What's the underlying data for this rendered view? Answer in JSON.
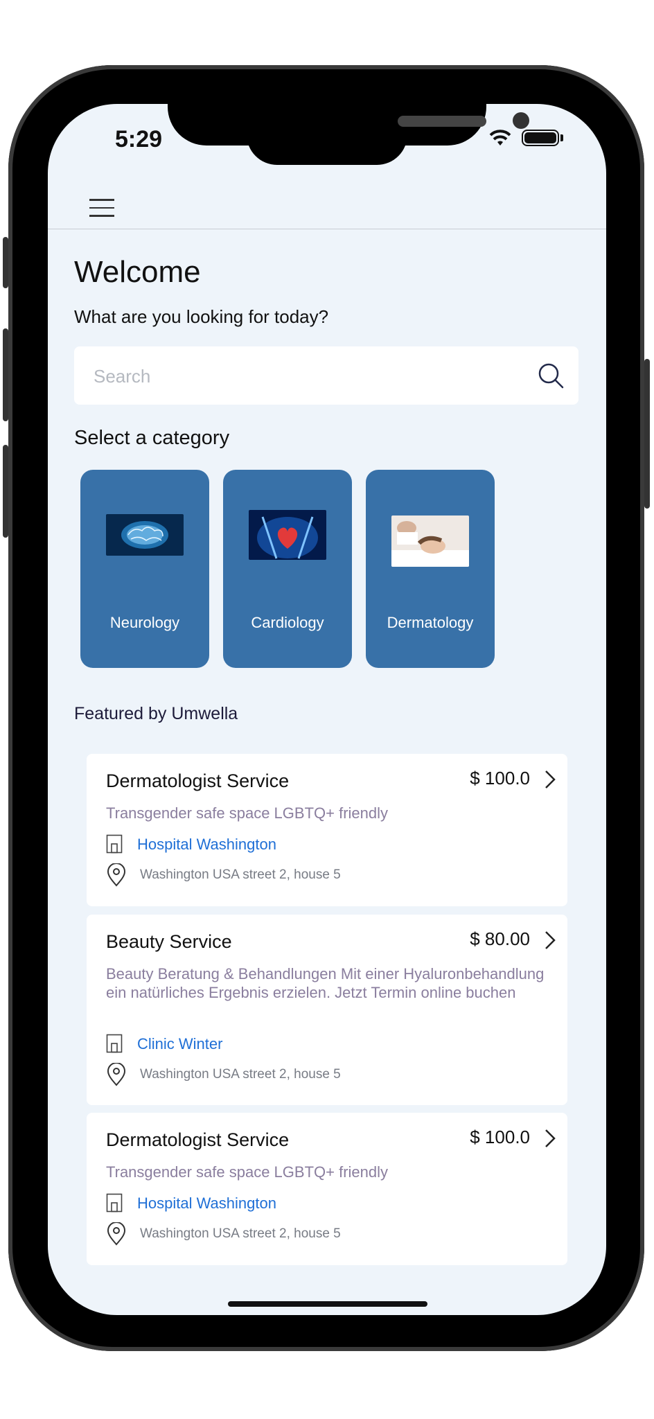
{
  "status_bar": {
    "time": "5:29"
  },
  "header": {
    "menu_icon": "hamburger-menu-icon"
  },
  "welcome": {
    "title": "Welcome",
    "subtitle": "What are you looking for today?"
  },
  "search": {
    "placeholder": "Search",
    "value": ""
  },
  "categories": {
    "title": "Select a category",
    "items": [
      {
        "label": "Neurology",
        "image": "brain-image"
      },
      {
        "label": "Cardiology",
        "image": "heart-image"
      },
      {
        "label": "Dermatology",
        "image": "facial-treatment-image"
      }
    ]
  },
  "featured": {
    "title": "Featured by Umwella",
    "cards": [
      {
        "title": "Dermatologist Service",
        "price": "$ 100.0",
        "description": "Transgender safe space LGBTQ+ friendly",
        "hospital": "Hospital Washington",
        "address": "Washington USA street 2, house 5"
      },
      {
        "title": "Beauty Service",
        "price": "$ 80.00",
        "description": "Beauty Beratung & Behandlungen Mit einer Hyaluronbehandlung ein natürliches Ergebnis erzielen. Jetzt Termin online buchen",
        "hospital": "Clinic Winter",
        "address": "Washington USA street 2, house 5"
      },
      {
        "title": "Dermatologist Service",
        "price": "$ 100.0",
        "description": "Transgender safe space LGBTQ+ friendly",
        "hospital": "Hospital Washington",
        "address": "Washington USA street 2, house 5"
      }
    ]
  },
  "colors": {
    "category_tile": "#3871a8",
    "link_blue": "#1f6fd6",
    "description_text": "#8a7e9e",
    "screen_background": "#eef4fa"
  }
}
